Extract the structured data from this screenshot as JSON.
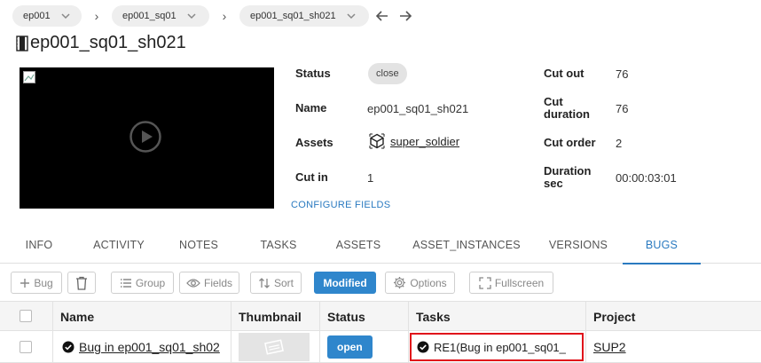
{
  "breadcrumb": {
    "items": [
      {
        "label": "ep001"
      },
      {
        "label": "ep001_sq01"
      },
      {
        "label": "ep001_sq01_sh021"
      }
    ]
  },
  "page": {
    "title": "ep001_sq01_sh021"
  },
  "details": {
    "status_label": "Status",
    "status_value": "close",
    "name_label": "Name",
    "name_value": "ep001_sq01_sh021",
    "assets_label": "Assets",
    "assets_value": "super_soldier",
    "cut_in_label": "Cut in",
    "cut_in_value": "1",
    "cut_out_label": "Cut out",
    "cut_out_value": "76",
    "cut_duration_label_1": "Cut",
    "cut_duration_label_2": "duration",
    "cut_duration_value": "76",
    "cut_order_label": "Cut order",
    "cut_order_value": "2",
    "duration_sec_label_1": "Duration",
    "duration_sec_label_2": "sec",
    "duration_sec_value": "00:00:03:01",
    "configure_fields": "CONFIGURE FIELDS"
  },
  "tabs": [
    {
      "label": "INFO"
    },
    {
      "label": "ACTIVITY"
    },
    {
      "label": "NOTES"
    },
    {
      "label": "TASKS"
    },
    {
      "label": "ASSETS"
    },
    {
      "label": "ASSET_INSTANCES"
    },
    {
      "label": "VERSIONS"
    },
    {
      "label": "BUGS",
      "active": true
    }
  ],
  "toolbar": {
    "add_bug": "Bug",
    "group": "Group",
    "fields": "Fields",
    "sort": "Sort",
    "modified": "Modified",
    "options": "Options",
    "fullscreen": "Fullscreen"
  },
  "table": {
    "columns": [
      "Name",
      "Thumbnail",
      "Status",
      "Tasks",
      "Project"
    ],
    "rows": [
      {
        "name": "Bug in ep001_sq01_sh02",
        "status": "open",
        "tasks": "RE1(Bug in ep001_sq01_",
        "project": "SUP2"
      }
    ]
  },
  "colors": {
    "accent": "#2a7ac0",
    "primary_button": "#2f86cc",
    "highlight_border": "#e0131b"
  }
}
